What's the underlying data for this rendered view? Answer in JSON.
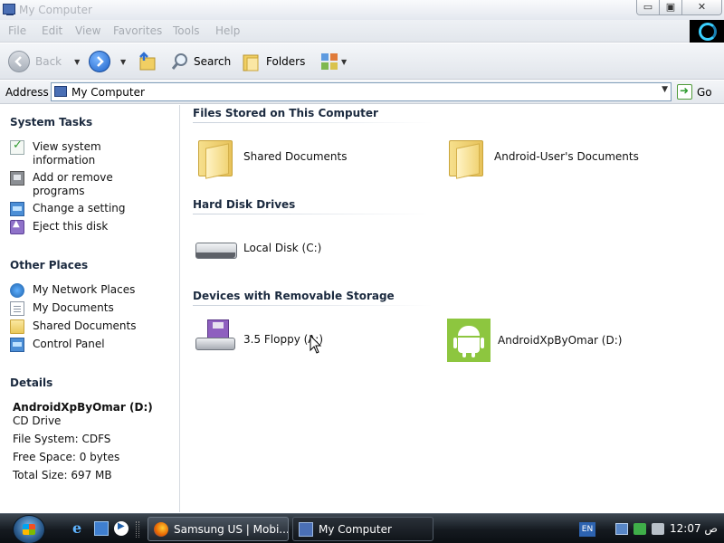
{
  "window": {
    "title": "My Computer",
    "buttons": {
      "minimize": "▭",
      "maximize": "▣",
      "close": "✕"
    }
  },
  "menu": [
    "File",
    "Edit",
    "View",
    "Favorites",
    "Tools",
    "Help"
  ],
  "toolbar": {
    "back": "Back",
    "search": "Search",
    "folders": "Folders"
  },
  "address": {
    "label": "Address",
    "value": "My Computer",
    "go": "Go"
  },
  "sidebar": {
    "system_tasks": {
      "title": "System Tasks",
      "items": [
        {
          "label": "View system information",
          "icon": "system-info-icon"
        },
        {
          "label": "Add or remove programs",
          "icon": "add-remove-programs-icon"
        },
        {
          "label": "Change a setting",
          "icon": "control-panel-icon"
        },
        {
          "label": "Eject this disk",
          "icon": "eject-icon"
        }
      ]
    },
    "other_places": {
      "title": "Other Places",
      "items": [
        {
          "label": "My Network Places",
          "icon": "network-places-icon"
        },
        {
          "label": "My Documents",
          "icon": "documents-icon"
        },
        {
          "label": "Shared Documents",
          "icon": "folder-icon"
        },
        {
          "label": "Control Panel",
          "icon": "control-panel-icon"
        }
      ]
    },
    "details": {
      "title": "Details",
      "name": "AndroidXpByOmar (D:)",
      "type": "CD Drive",
      "file_system": "File System: CDFS",
      "free_space": "Free Space: 0 bytes",
      "total_size": "Total Size: 697 MB"
    }
  },
  "content": {
    "groups": [
      {
        "title": "Files Stored on This Computer",
        "items": [
          {
            "label": "Shared Documents",
            "icon": "folder-icon"
          },
          {
            "label": "Android-User's Documents",
            "icon": "folder-icon"
          }
        ]
      },
      {
        "title": "Hard Disk Drives",
        "items": [
          {
            "label": "Local Disk (C:)",
            "icon": "hard-disk-icon"
          }
        ]
      },
      {
        "title": "Devices with Removable Storage",
        "items": [
          {
            "label": "3.5 Floppy (A:)",
            "icon": "floppy-drive-icon"
          },
          {
            "label": "AndroidXpByOmar (D:)",
            "icon": "android-cd-drive-icon"
          }
        ]
      }
    ]
  },
  "taskbar": {
    "tasks": [
      {
        "label": "Samsung US | Mobi...",
        "icon": "firefox-icon"
      },
      {
        "label": "My Computer",
        "icon": "my-computer-icon"
      }
    ],
    "language": "EN",
    "clock": "12:07 ص"
  },
  "colors": {
    "android_green": "#8dc63f",
    "link_text": "#111111",
    "taskbar_bg": "#151a20"
  }
}
